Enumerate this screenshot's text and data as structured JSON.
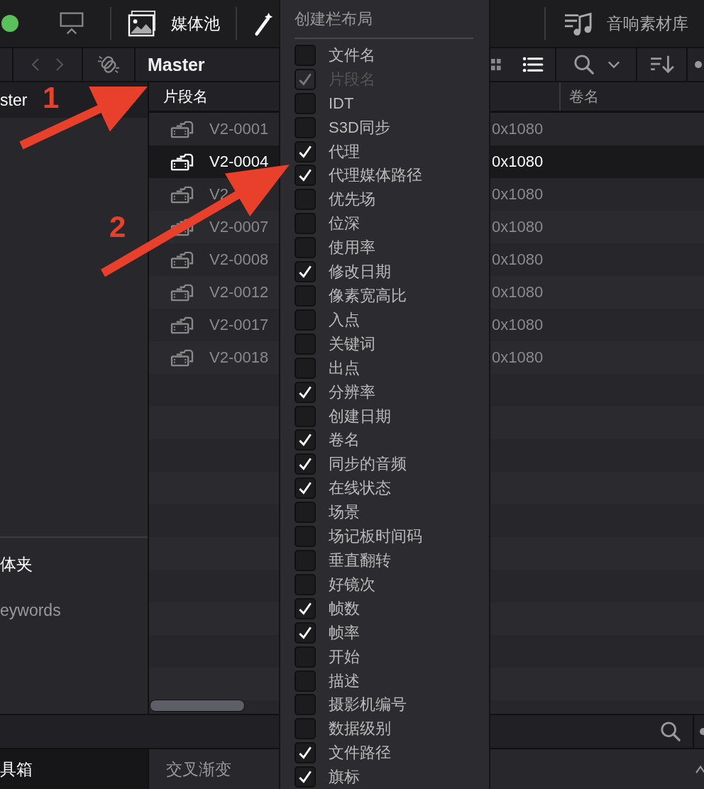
{
  "top_bar": {
    "media_pool_tab": {
      "label": "媒体池"
    },
    "sound_library_tab": {
      "label": "音响素材库"
    }
  },
  "toolbar": {
    "title": "Master"
  },
  "bin_list": {
    "label": "ster"
  },
  "smart_bins": {
    "title": "体夹",
    "items": [
      {
        "label": "eywords"
      }
    ]
  },
  "table": {
    "columns": [
      {
        "label": "片段名"
      },
      {
        "label": "卷名"
      }
    ],
    "rows": [
      {
        "name": "V2-0001",
        "resolution": "0x1080",
        "selected": false
      },
      {
        "name": "V2-0004",
        "resolution": "0x1080",
        "selected": true
      },
      {
        "name": "V2",
        "resolution": "0x1080",
        "selected": false
      },
      {
        "name": "V2-0007",
        "resolution": "0x1080",
        "selected": false
      },
      {
        "name": "V2-0008",
        "resolution": "0x1080",
        "selected": false
      },
      {
        "name": "V2-0012",
        "resolution": "0x1080",
        "selected": false
      },
      {
        "name": "V2-0017",
        "resolution": "0x1080",
        "selected": false
      },
      {
        "name": "V2-0018",
        "resolution": "0x1080",
        "selected": false
      }
    ]
  },
  "bottom": {
    "toolbox": "具箱",
    "effect": "交叉渐变"
  },
  "menu": {
    "title": "创建栏布局",
    "items": [
      {
        "label": "文件名",
        "checked": false,
        "disabled": false
      },
      {
        "label": "片段名",
        "checked": true,
        "disabled": true
      },
      {
        "label": "IDT",
        "checked": false,
        "disabled": false
      },
      {
        "label": "S3D同步",
        "checked": false,
        "disabled": false
      },
      {
        "label": "代理",
        "checked": true,
        "disabled": false
      },
      {
        "label": "代理媒体路径",
        "checked": true,
        "disabled": false
      },
      {
        "label": "优先场",
        "checked": false,
        "disabled": false
      },
      {
        "label": "位深",
        "checked": false,
        "disabled": false
      },
      {
        "label": "使用率",
        "checked": false,
        "disabled": false
      },
      {
        "label": "修改日期",
        "checked": true,
        "disabled": false
      },
      {
        "label": "像素宽高比",
        "checked": false,
        "disabled": false
      },
      {
        "label": "入点",
        "checked": false,
        "disabled": false
      },
      {
        "label": "关键词",
        "checked": false,
        "disabled": false
      },
      {
        "label": "出点",
        "checked": false,
        "disabled": false
      },
      {
        "label": "分辨率",
        "checked": true,
        "disabled": false
      },
      {
        "label": "创建日期",
        "checked": false,
        "disabled": false
      },
      {
        "label": "卷名",
        "checked": true,
        "disabled": false
      },
      {
        "label": "同步的音频",
        "checked": true,
        "disabled": false
      },
      {
        "label": "在线状态",
        "checked": true,
        "disabled": false
      },
      {
        "label": "场景",
        "checked": false,
        "disabled": false
      },
      {
        "label": "场记板时间码",
        "checked": false,
        "disabled": false
      },
      {
        "label": "垂直翻转",
        "checked": false,
        "disabled": false
      },
      {
        "label": "好镜次",
        "checked": false,
        "disabled": false
      },
      {
        "label": "帧数",
        "checked": true,
        "disabled": false
      },
      {
        "label": "帧率",
        "checked": true,
        "disabled": false
      },
      {
        "label": "开始",
        "checked": false,
        "disabled": false
      },
      {
        "label": "描述",
        "checked": false,
        "disabled": false
      },
      {
        "label": "摄影机编号",
        "checked": false,
        "disabled": false
      },
      {
        "label": "数据级别",
        "checked": false,
        "disabled": false
      },
      {
        "label": "文件路径",
        "checked": true,
        "disabled": false
      },
      {
        "label": "旗标",
        "checked": true,
        "disabled": false
      }
    ]
  },
  "annotations": [
    {
      "label": "1"
    },
    {
      "label": "2"
    }
  ]
}
